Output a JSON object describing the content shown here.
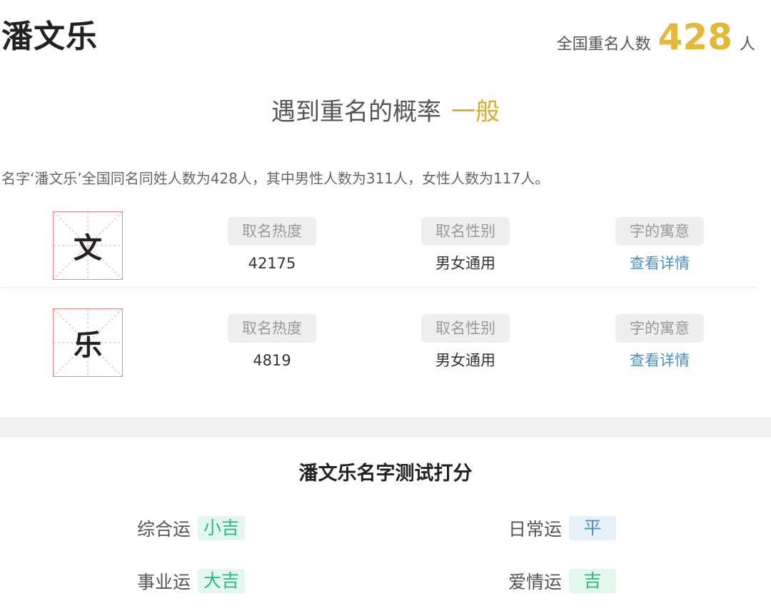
{
  "header": {
    "name": "潘文乐",
    "same_name_label": "全国重名人数",
    "same_name_count": "428",
    "same_name_unit": "人"
  },
  "probability": {
    "label": "遇到重名的概率",
    "level": "一般"
  },
  "description": "名字‘潘文乐’全国同名同姓人数为428人，其中男性人数为311人，女性人数为117人。",
  "characters": [
    {
      "char": "文",
      "popularity_label": "取名热度",
      "popularity": "42175",
      "gender_label": "取名性别",
      "gender": "男女通用",
      "meaning_label": "字的寓意",
      "meaning_link": "查看详情"
    },
    {
      "char": "乐",
      "popularity_label": "取名热度",
      "popularity": "4819",
      "gender_label": "取名性别",
      "gender": "男女通用",
      "meaning_label": "字的寓意",
      "meaning_link": "查看详情"
    }
  ],
  "score": {
    "title": "潘文乐名字测试打分",
    "items": [
      {
        "label": "综合运",
        "value": "小吉"
      },
      {
        "label": "日常运",
        "value": "平"
      },
      {
        "label": "事业运",
        "value": "大吉"
      },
      {
        "label": "爱情运",
        "value": "吉"
      }
    ]
  },
  "colors": {
    "accent_gold": "#e2b93b",
    "link_blue": "#4a90c2",
    "lucky_green": "#2cb98a",
    "grid_red": "#e88a8a"
  }
}
